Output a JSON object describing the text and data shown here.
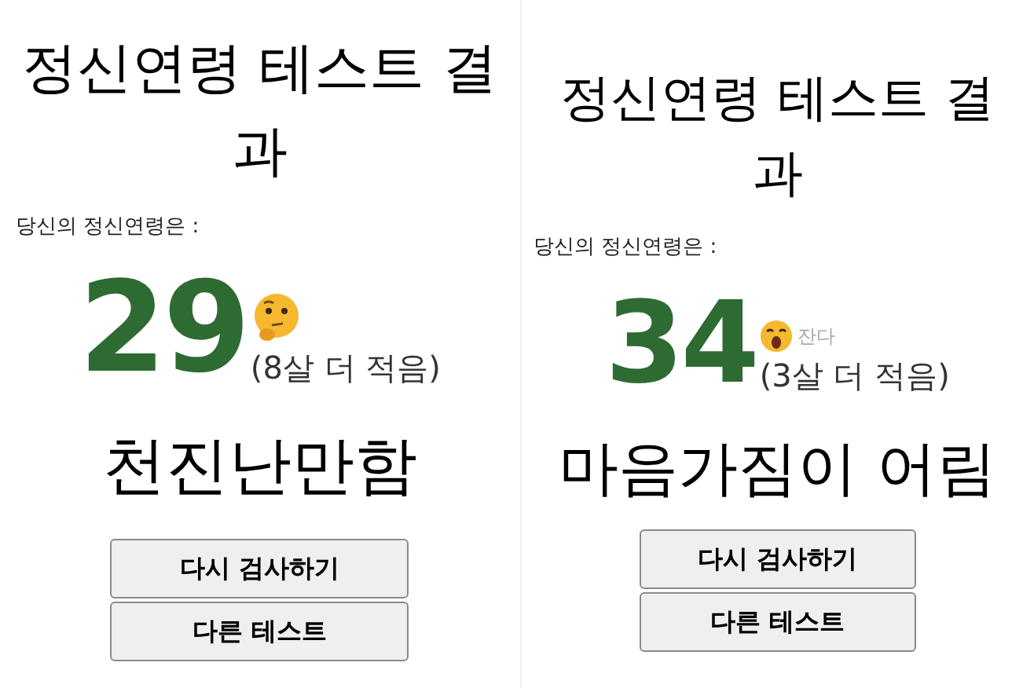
{
  "panels": [
    {
      "title": "정신연령 테스트 결과",
      "label": "당신의 정신연령은 :",
      "age": "29",
      "emoji": {
        "kind": "thinking"
      },
      "difference": "(8살 더 적음)",
      "result": "천진난만함",
      "buttons": [
        "다시 검사하기",
        "다른 테스트"
      ]
    },
    {
      "title": "정신연령 테스트 결과",
      "label": "당신의 정신연령은 :",
      "age": "34",
      "emoji": {
        "kind": "yawning"
      },
      "emoji_caption": "잔다",
      "difference": "(3살 더 적음)",
      "result": "마음가짐이 어림",
      "buttons": [
        "다시 검사하기",
        "다른 테스트"
      ]
    }
  ]
}
